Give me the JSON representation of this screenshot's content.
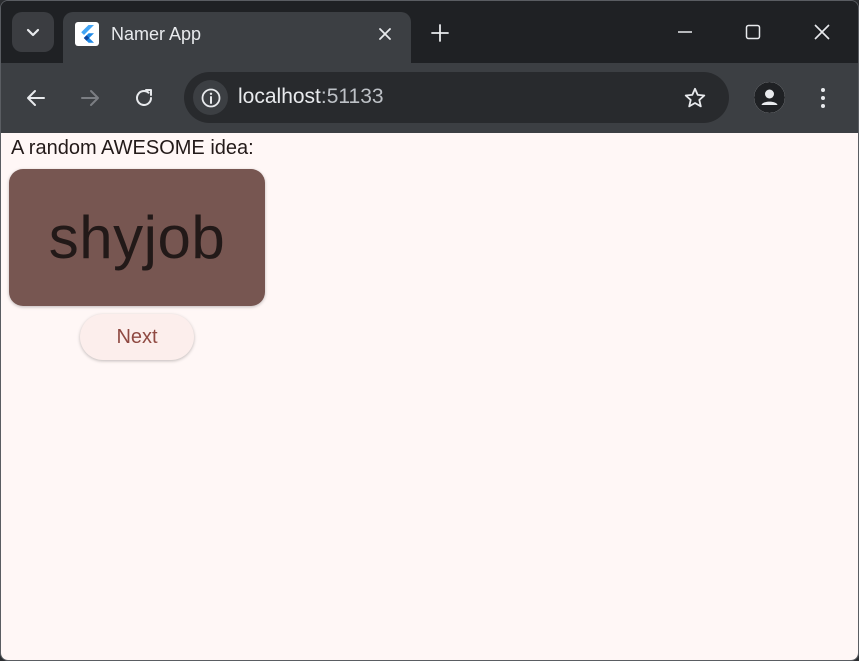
{
  "browser": {
    "tab": {
      "title": "Namer App"
    },
    "address_bar": {
      "host": "localhost",
      "port": ":51133"
    }
  },
  "app": {
    "caption": "A random AWESOME idea:",
    "word_pair": "shyjob",
    "next_label": "Next"
  },
  "icons": {
    "tab_search": "chevron-down-icon",
    "favicon": "flutter-logo-icon",
    "tab_close": "close-icon",
    "new_tab": "plus-icon",
    "minimize": "minimize-icon",
    "maximize": "maximize-icon",
    "window_close": "close-icon",
    "back": "arrow-left-icon",
    "forward": "arrow-right-icon",
    "reload": "reload-icon",
    "site_info": "info-icon",
    "bookmark": "star-icon",
    "profile": "person-icon",
    "menu": "kebab-menu-icon"
  },
  "colors": {
    "page_background": "#fff7f6",
    "card_background": "#775651",
    "button_text": "#904a43",
    "button_background": "#fceeec"
  }
}
